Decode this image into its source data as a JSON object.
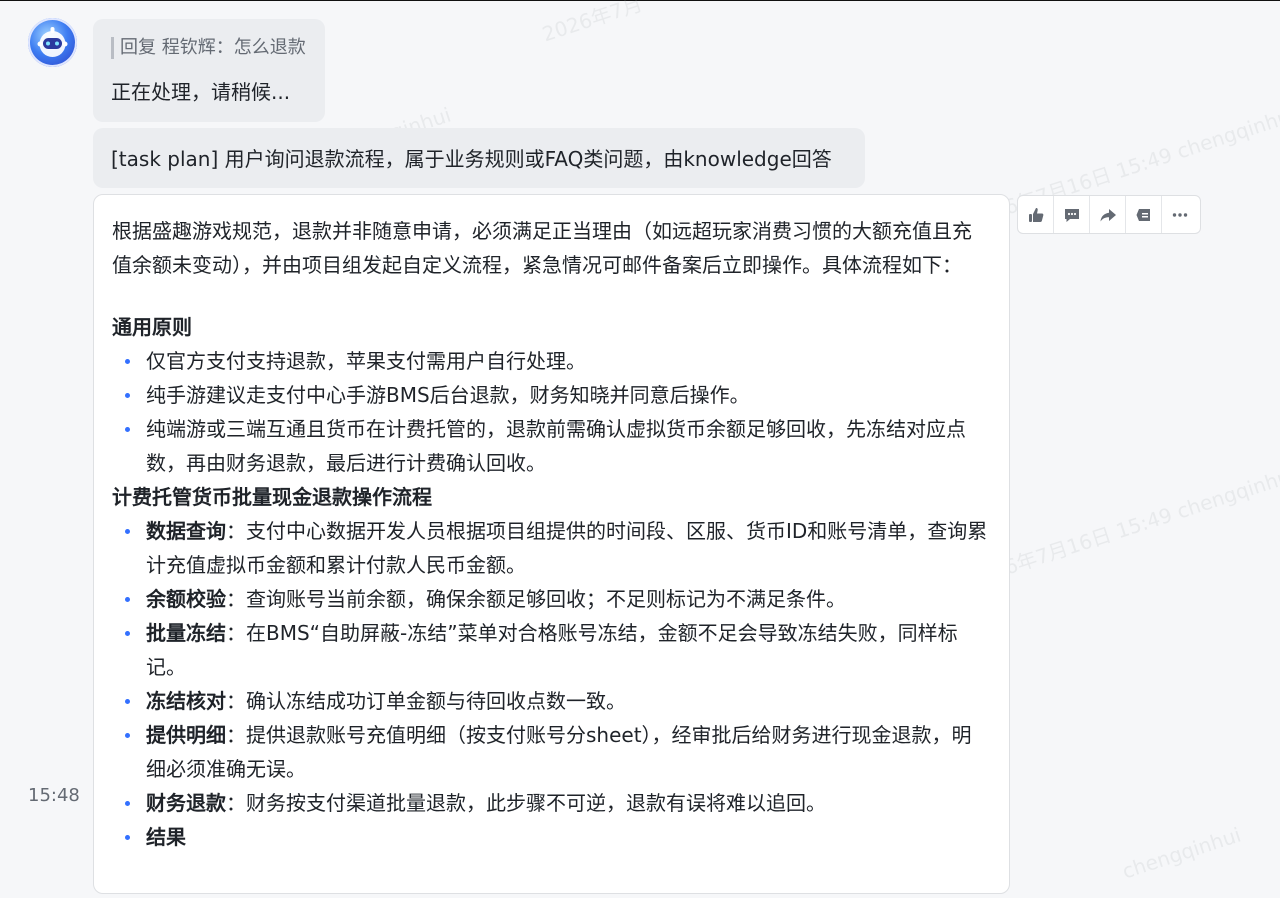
{
  "reply_bubble": {
    "quote": "回复 程钦辉：怎么退款",
    "text": "正在处理，请稍候..."
  },
  "plan_bubble": {
    "text": "[task plan] 用户询问退款流程，属于业务规则或FAQ类问题，由knowledge回答"
  },
  "answer": {
    "intro": "根据盛趣游戏规范，退款并非随意申请，必须满足正当理由（如远超玩家消费习惯的大额充值且充值余额未变动），并由项目组发起自定义流程，紧急情况可邮件备案后立即操作。具体流程如下：",
    "section1_title": "通用原则",
    "section1_items": [
      "仅官方支付支持退款，苹果支付需用户自行处理。",
      "纯手游建议走支付中心手游BMS后台退款，财务知晓并同意后操作。",
      "纯端游或三端互通且货币在计费托管的，退款前需确认虚拟货币余额足够回收，先冻结对应点数，再由财务退款，最后进行计费确认回收。"
    ],
    "section2_title": "计费托管货币批量现金退款操作流程",
    "section2_items": [
      {
        "label": "数据查询",
        "text": "：支付中心数据开发人员根据项目组提供的时间段、区服、货币ID和账号清单，查询累计充值虚拟币金额和累计付款人民币金额。"
      },
      {
        "label": "余额校验",
        "text": "：查询账号当前余额，确保余额足够回收；不足则标记为不满足条件。"
      },
      {
        "label": "批量冻结",
        "text": "：在BMS“自助屏蔽-冻结”菜单对合格账号冻结，金额不足会导致冻结失败，同样标记。"
      },
      {
        "label": "冻结核对",
        "text": "：确认冻结成功订单金额与待回收点数一致。"
      },
      {
        "label": "提供明细",
        "text": "：提供退款账号充值明细（按支付账号分sheet），经审批后给财务进行现金退款，明细必须准确无误。"
      },
      {
        "label": "财务退款",
        "text": "：财务按支付渠道批量退款，此步骤不可逆，退款有误将难以追回。"
      },
      {
        "label": "结果",
        "text": ""
      }
    ]
  },
  "timestamp": "15:48",
  "toolbar": {
    "icons": [
      "thumbs-up-icon",
      "comment-icon",
      "forward-icon",
      "quote-icon",
      "more-icon"
    ]
  },
  "watermark": {
    "texts": [
      "2026年7月",
      "chengqinhui",
      "2026年7月16日 15:49 chengqinhui",
      "2026年7月16日 15:49 chengqinhui",
      "2026年7月16日 15:49 chengqinhui",
      "2026年7月16日 15:49",
      "15:49 chengqinhui",
      "chengqinhui"
    ]
  },
  "colors": {
    "accent": "#3370ff",
    "bubble": "#ebedf0",
    "card_border": "#dee0e3"
  }
}
